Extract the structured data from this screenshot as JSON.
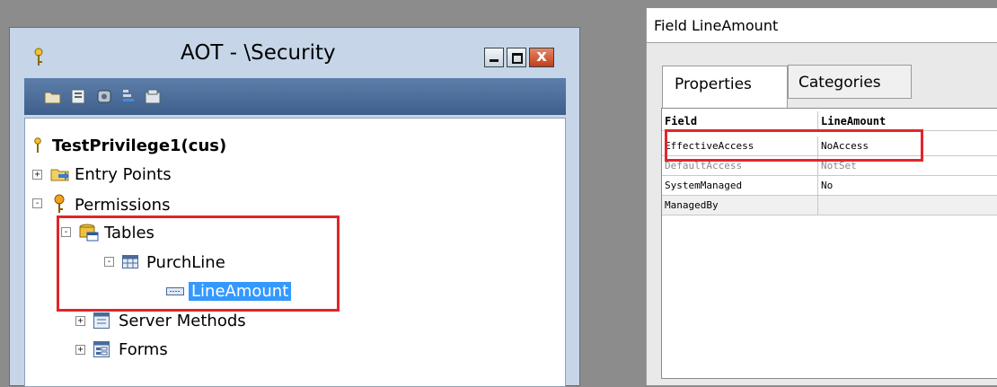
{
  "aot": {
    "title": "AOT - \\Security",
    "close_glyph": "x",
    "toolbar_icons": [
      "open-icon",
      "properties-icon",
      "compile-icon",
      "sort-icon",
      "save-icon"
    ],
    "tree": {
      "root": "TestPrivilege1(cus)",
      "entry_points": "Entry Points",
      "permissions": "Permissions",
      "tables": "Tables",
      "purchline": "PurchLine",
      "lineamount": "LineAmount",
      "server_methods": "Server Methods",
      "forms": "Forms"
    }
  },
  "props": {
    "title": "Field LineAmount",
    "tabs": [
      "Properties",
      "Categories"
    ],
    "grid": {
      "header": {
        "name": "Field",
        "value": "LineAmount"
      },
      "rows": [
        {
          "name": "EffectiveAccess",
          "value": "NoAccess"
        },
        {
          "name": "DefaultAccess",
          "value": "NotSet"
        },
        {
          "name": "SystemManaged",
          "value": "No"
        },
        {
          "name": "ManagedBy",
          "value": ""
        }
      ]
    }
  },
  "colors": {
    "highlight": "#e0262a",
    "selection": "#3399ff",
    "toolbar": "#4b6c98"
  }
}
